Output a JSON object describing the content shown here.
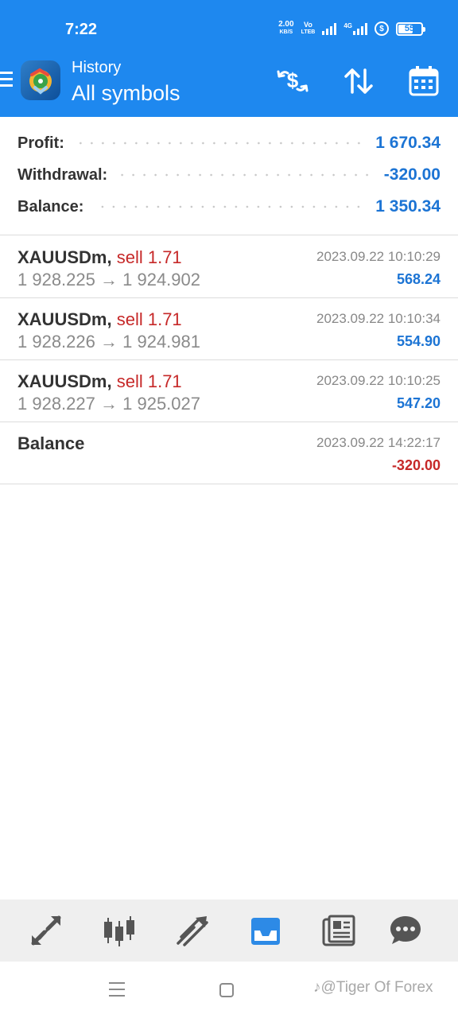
{
  "status_bar": {
    "time": "7:22",
    "speed_value": "2.00",
    "speed_unit": "KB/S",
    "volte_top": "Vo",
    "volte_bottom": "LTEB",
    "network": "4G",
    "battery": "55"
  },
  "app_bar": {
    "title": "History",
    "subtitle": "All symbols",
    "icons": [
      "menu-icon",
      "metatrader-logo",
      "deposit-dollar-icon",
      "sort-icon",
      "calendar-icon"
    ]
  },
  "summary": {
    "profit_label": "Profit:",
    "profit_value": "1 670.34",
    "withdrawal_label": "Withdrawal:",
    "withdrawal_value": "-320.00",
    "balance_label": "Balance:",
    "balance_value": "1 350.34"
  },
  "deals": [
    {
      "symbol": "XAUUSDm",
      "separator": ",",
      "type": "sell 1.71",
      "open_price": "1 928.225",
      "arrow": "→",
      "close_price": "1 924.902",
      "time": "2023.09.22 10:10:29",
      "profit": "568.24"
    },
    {
      "symbol": "XAUUSDm",
      "separator": ",",
      "type": "sell 1.71",
      "open_price": "1 928.226",
      "arrow": "→",
      "close_price": "1 924.981",
      "time": "2023.09.22 10:10:34",
      "profit": "554.90"
    },
    {
      "symbol": "XAUUSDm",
      "separator": ",",
      "type": "sell 1.71",
      "open_price": "1 928.227",
      "arrow": "→",
      "close_price": "1 925.027",
      "time": "2023.09.22 10:10:25",
      "profit": "547.20"
    }
  ],
  "balance_entry": {
    "title": "Balance",
    "time": "2023.09.22 14:22:17",
    "amount": "-320.00"
  },
  "bottom_nav": {
    "items": [
      "quotes-icon",
      "chart-icon",
      "trade-icon",
      "history-icon",
      "news-icon",
      "messages-icon"
    ],
    "active": "history-icon",
    "active_color": "#2d8ae6",
    "inactive_color": "#555555"
  },
  "watermark": "@Tiger Of Forex",
  "colors": {
    "header": "#1e88ef",
    "value_blue": "#1c74d4",
    "sell_red": "#c62828"
  }
}
